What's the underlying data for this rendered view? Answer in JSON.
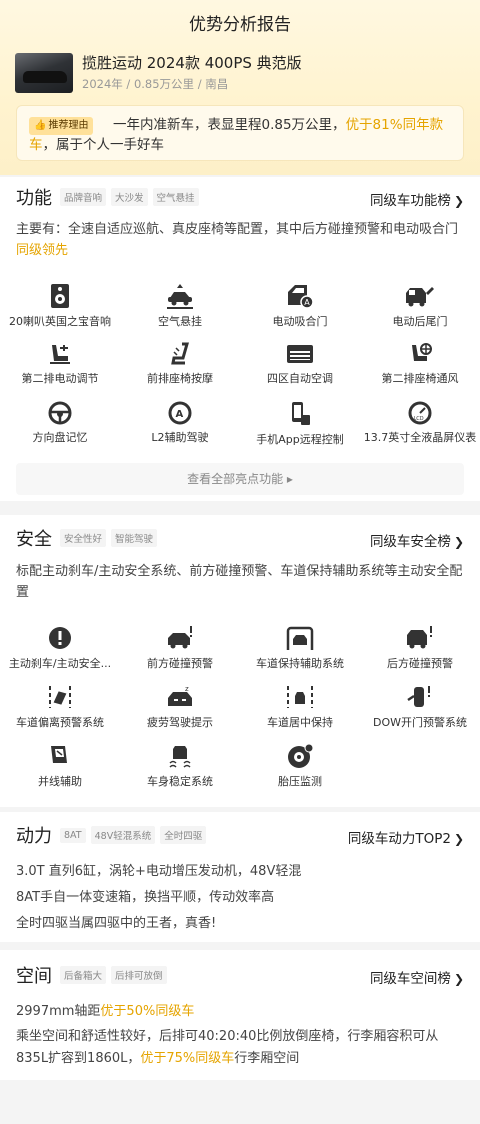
{
  "page_title": "优势分析报告",
  "car": {
    "name": "揽胜运动 2024款 400PS 典范版",
    "meta": "2024年 / 0.85万公里 / 南昌"
  },
  "reason": {
    "badge": "推荐理由",
    "text_a": "一年内准新车，表显里程0.85万公里，",
    "text_hl": "优于81%同年款车",
    "text_b": "，属于个人一手好车"
  },
  "function": {
    "title": "功能",
    "tags": [
      "品牌音响",
      "大沙发",
      "空气悬挂"
    ],
    "rank_label": "同级车功能榜",
    "desc_a": "主要有：全速自适应巡航、真皮座椅等配置，其中后方碰撞预警和电动吸合门",
    "desc_hl": "同级领先",
    "items": [
      {
        "label": "20喇叭英国之宝音响",
        "icon": "speaker-icon"
      },
      {
        "label": "空气悬挂",
        "icon": "air-suspension-icon"
      },
      {
        "label": "电动吸合门",
        "icon": "soft-close-door-icon"
      },
      {
        "label": "电动后尾门",
        "icon": "power-tailgate-icon"
      },
      {
        "label": "第二排电动调节",
        "icon": "seat-adjust-icon"
      },
      {
        "label": "前排座椅按摩",
        "icon": "seat-massage-icon"
      },
      {
        "label": "四区自动空调",
        "icon": "climate-control-icon"
      },
      {
        "label": "第二排座椅通风",
        "icon": "seat-ventilation-icon"
      },
      {
        "label": "方向盘记忆",
        "icon": "steering-wheel-icon"
      },
      {
        "label": "L2辅助驾驶",
        "icon": "driver-assist-icon"
      },
      {
        "label": "手机App远程控制",
        "icon": "phone-remote-icon"
      },
      {
        "label": "13.7英寸全液晶屏仪表",
        "icon": "lcd-cluster-icon"
      }
    ],
    "more_label": "查看全部亮点功能"
  },
  "safety": {
    "title": "安全",
    "tags": [
      "安全性好",
      "智能驾驶"
    ],
    "rank_label": "同级车安全榜",
    "desc": "标配主动刹车/主动安全系统、前方碰撞预警、车道保持辅助系统等主动安全配置",
    "items": [
      {
        "label": "主动刹车/主动安全...",
        "icon": "active-brake-icon"
      },
      {
        "label": "前方碰撞预警",
        "icon": "front-collision-icon"
      },
      {
        "label": "车道保持辅助系统",
        "icon": "lane-keep-icon"
      },
      {
        "label": "后方碰撞预警",
        "icon": "rear-collision-icon"
      },
      {
        "label": "车道偏离预警系统",
        "icon": "lane-departure-icon"
      },
      {
        "label": "疲劳驾驶提示",
        "icon": "fatigue-alert-icon"
      },
      {
        "label": "车道居中保持",
        "icon": "lane-center-icon"
      },
      {
        "label": "DOW开门预警系统",
        "icon": "door-open-warning-icon"
      },
      {
        "label": "并线辅助",
        "icon": "blind-spot-icon"
      },
      {
        "label": "车身稳定系统",
        "icon": "stability-control-icon"
      },
      {
        "label": "胎压监测",
        "icon": "tire-pressure-icon"
      }
    ]
  },
  "power": {
    "title": "动力",
    "tags": [
      "8AT",
      "48V轻混系统",
      "全时四驱"
    ],
    "rank_label": "同级车动力TOP2",
    "lines": [
      "3.0T 直列6缸，涡轮+电动增压发动机，48V轻混",
      "8AT手自一体变速箱，换挡平顺，传动效率高",
      "全时四驱当属四驱中的王者，真香!"
    ]
  },
  "space": {
    "title": "空间",
    "tags": [
      "后备箱大",
      "后排可放倒"
    ],
    "rank_label": "同级车空间榜",
    "line1_a": "2997mm轴距",
    "line1_hl": "优于50%同级车",
    "line2_a": "乘坐空间和舒适性较好，后排可40:20:40比例放倒座椅，行李厢容积可从835L扩容到1860L，",
    "line2_hl": "优于75%同级车",
    "line2_b": "行李厢空间"
  },
  "colors": {
    "highlight": "#e5a400",
    "badge_bg": "#ffe19a"
  }
}
